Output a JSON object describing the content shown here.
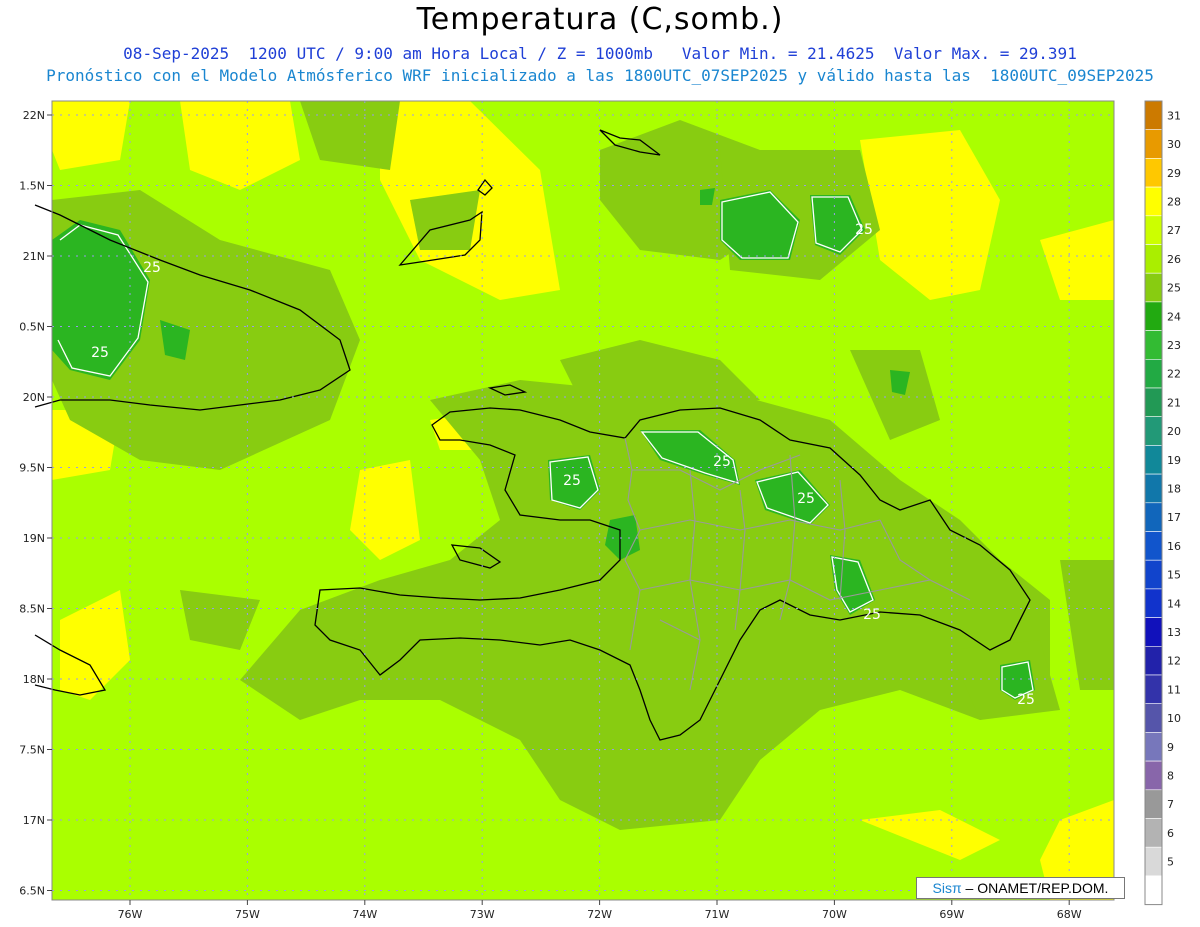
{
  "title": "Temperatura (C,somb.)",
  "subtitle_line1": "08-Sep-2025  1200 UTC / 9:00 am Hora Local / Z = 1000mb   Valor Min. = 21.4625  Valor Max. = 29.391",
  "subtitle_line2": "Pronóstico con el Modelo Atmósferico WRF inicializado a las 1800UTC_07SEP2025 y válido hasta las  1800UTC_09SEP2025",
  "map": {
    "lat_labels": [
      "22N",
      "1.5N",
      "21N",
      "0.5N",
      "20N",
      "9.5N",
      "19N",
      "8.5N",
      "18N",
      "7.5N",
      "17N",
      "6.5N"
    ],
    "lon_labels": [
      "76W",
      "75W",
      "74W",
      "73W",
      "72W",
      "71W",
      "70W",
      "69W",
      "68W"
    ],
    "contour_label": "25",
    "colors": {
      "background": "#aaff00",
      "warm": "#ffff00",
      "mid": "#88cc11",
      "cool": "#2bb521",
      "coast": "#000000",
      "borders": "#9a9a9a",
      "grid": "#9999ee"
    }
  },
  "colorbar": {
    "levels": [
      {
        "label": "31",
        "color": "#cc7a00"
      },
      {
        "label": "30",
        "color": "#e89a00"
      },
      {
        "label": "29",
        "color": "#ffc800"
      },
      {
        "label": "28",
        "color": "#ffff00"
      },
      {
        "label": "27",
        "color": "#ccff00"
      },
      {
        "label": "26",
        "color": "#aaee00"
      },
      {
        "label": "25",
        "color": "#88cc11"
      },
      {
        "label": "24",
        "color": "#22aa11"
      },
      {
        "label": "23",
        "color": "#33bb33"
      },
      {
        "label": "22",
        "color": "#22aa44"
      },
      {
        "label": "21",
        "color": "#229955"
      },
      {
        "label": "20",
        "color": "#229977"
      },
      {
        "label": "19",
        "color": "#118899"
      },
      {
        "label": "18",
        "color": "#1177aa"
      },
      {
        "label": "17",
        "color": "#1166bb"
      },
      {
        "label": "16",
        "color": "#1155cc"
      },
      {
        "label": "15",
        "color": "#1144cc"
      },
      {
        "label": "14",
        "color": "#1133cc"
      },
      {
        "label": "13",
        "color": "#1111bb"
      },
      {
        "label": "12",
        "color": "#2222aa"
      },
      {
        "label": "11",
        "color": "#3333aa"
      },
      {
        "label": "10",
        "color": "#5555aa"
      },
      {
        "label": "9",
        "color": "#7777bb"
      },
      {
        "label": "8",
        "color": "#8866aa"
      },
      {
        "label": "7",
        "color": "#999999"
      },
      {
        "label": "6",
        "color": "#b3b3b3"
      },
      {
        "label": "5",
        "color": "#d9d9d9"
      },
      {
        "label": "",
        "color": "#ffffff"
      }
    ]
  },
  "credit": {
    "brand": "Sisπ",
    "text": " – ONAMET/REP.DOM."
  }
}
